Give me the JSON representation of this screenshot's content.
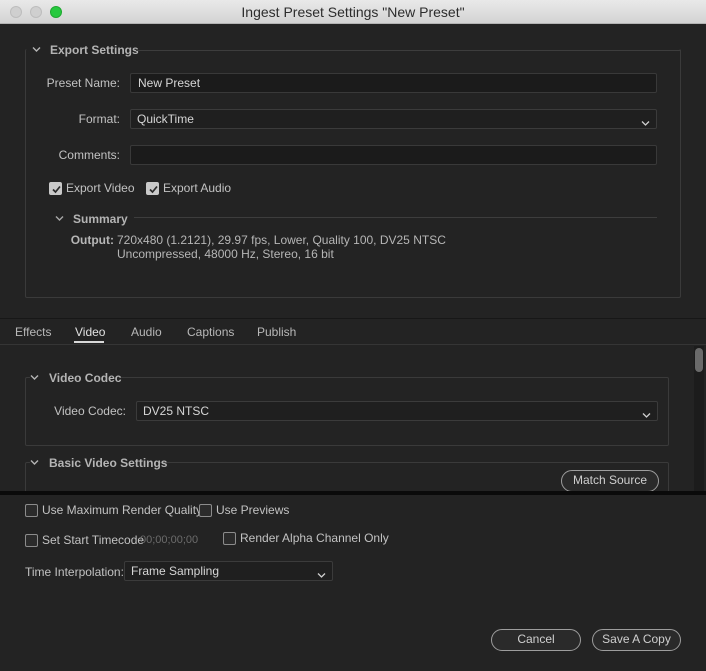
{
  "window": {
    "title": "Ingest Preset Settings \"New Preset\""
  },
  "export_settings": {
    "heading": "Export Settings",
    "preset_name_label": "Preset Name:",
    "preset_name_value": "New Preset",
    "format_label": "Format:",
    "format_value": "QuickTime",
    "comments_label": "Comments:",
    "comments_value": "",
    "export_video_label": "Export Video",
    "export_video_checked": true,
    "export_audio_label": "Export Audio",
    "export_audio_checked": true,
    "summary_heading": "Summary",
    "output_label": "Output:",
    "output_line1": "720x480 (1.2121), 29.97 fps, Lower, Quality 100, DV25 NTSC",
    "output_line2": "Uncompressed, 48000 Hz, Stereo, 16 bit"
  },
  "tabs": [
    {
      "label": "Effects",
      "active": false
    },
    {
      "label": "Video",
      "active": true
    },
    {
      "label": "Audio",
      "active": false
    },
    {
      "label": "Captions",
      "active": false
    },
    {
      "label": "Publish",
      "active": false
    }
  ],
  "video": {
    "codec_section_heading": "Video Codec",
    "codec_label": "Video Codec:",
    "codec_value": "DV25 NTSC",
    "basic_heading": "Basic Video Settings",
    "match_source_label": "Match Source"
  },
  "bottom": {
    "max_render_quality_label": "Use Maximum Render Quality",
    "max_render_quality_checked": false,
    "use_previews_label": "Use Previews",
    "use_previews_checked": false,
    "set_start_timecode_label": "Set Start Timecode",
    "set_start_timecode_checked": false,
    "timecode_value": "00;00;00;00",
    "render_alpha_label": "Render Alpha Channel Only",
    "render_alpha_checked": false,
    "time_interp_label": "Time Interpolation:",
    "time_interp_value": "Frame Sampling",
    "cancel_label": "Cancel",
    "save_copy_label": "Save A Copy"
  },
  "colors": {
    "background": "#232323",
    "field_bg": "#1b1b1b",
    "traffic_light_active": "#27c93f"
  }
}
